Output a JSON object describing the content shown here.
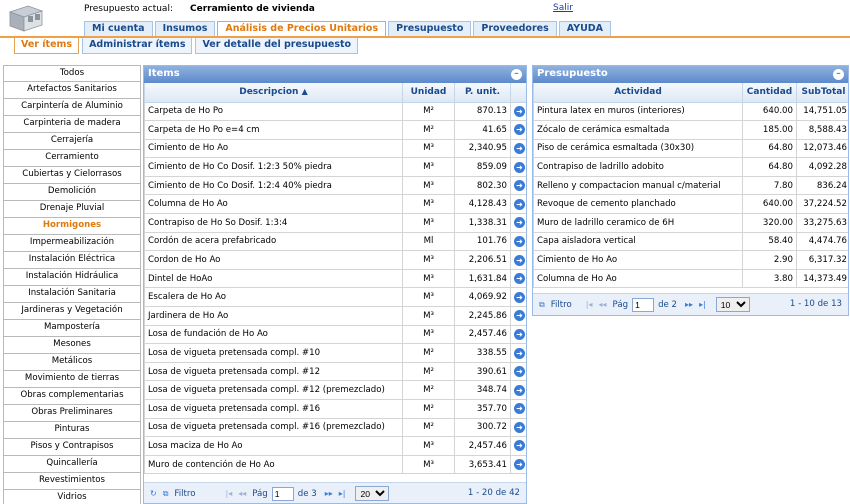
{
  "header": {
    "budget_label": "Presupuesto actual:",
    "budget_name": "Cerramiento de vivienda",
    "logout": "Salir"
  },
  "main_tabs": [
    "Mi cuenta",
    "Insumos",
    "Análisis de Precios Unitarios",
    "Presupuesto",
    "Proveedores",
    "AYUDA"
  ],
  "main_tab_active": 2,
  "sub_tabs": [
    "Ver ítems",
    "Administrar ítems",
    "Ver detalle del presupuesto"
  ],
  "sub_tab_active": 0,
  "categories": [
    "Todos",
    "Artefactos Sanitarios",
    "Carpintería de Aluminio",
    "Carpinteria de madera",
    "Cerrajería",
    "Cerramiento",
    "Cubiertas y Cielorrasos",
    "Demolición",
    "Drenaje Pluvial",
    "Hormigones",
    "Impermeabilización",
    "Instalación Eléctrica",
    "Instalación Hidráulica",
    "Instalación Sanitaria",
    "Jardineras y Vegetación",
    "Mampostería",
    "Mesones",
    "Metálicos",
    "Movimiento de tierras",
    "Obras complementarias",
    "Obras Preliminares",
    "Pinturas",
    "Pisos y Contrapisos",
    "Quincallería",
    "Revestimientos",
    "Vidrios"
  ],
  "category_active": 9,
  "items_panel": {
    "title": "Items",
    "columns": [
      "Descripcion",
      "Unidad",
      "P. unit."
    ],
    "rows": [
      [
        "Carpeta de Ho Po",
        "M²",
        "870.13"
      ],
      [
        "Carpeta de Ho Po e=4 cm",
        "M²",
        "41.65"
      ],
      [
        "Cimiento de Ho Ao",
        "M³",
        "2,340.95"
      ],
      [
        "Cimiento de Ho Co Dosif. 1:2:3 50% piedra",
        "M³",
        "859.09"
      ],
      [
        "Cimiento de Ho Co Dosif. 1:2:4 40% piedra",
        "M³",
        "802.30"
      ],
      [
        "Columna de Ho Ao",
        "M³",
        "4,128.43"
      ],
      [
        "Contrapiso de Ho So Dosif. 1:3:4",
        "M³",
        "1,338.31"
      ],
      [
        "Cordón de acera prefabricado",
        "Ml",
        "101.76"
      ],
      [
        "Cordon de Ho Ao",
        "M³",
        "2,206.51"
      ],
      [
        "Dintel de HoAo",
        "M³",
        "1,631.84"
      ],
      [
        "Escalera de Ho Ao",
        "M³",
        "4,069.92"
      ],
      [
        "Jardinera de Ho Ao",
        "M³",
        "2,245.86"
      ],
      [
        "Losa de fundación de Ho Ao",
        "M³",
        "2,457.46"
      ],
      [
        "Losa de vigueta pretensada compl. #10",
        "M²",
        "338.55"
      ],
      [
        "Losa de vigueta pretensada compl. #12",
        "M²",
        "390.61"
      ],
      [
        "Losa de vigueta pretensada compl. #12 (premezclado)",
        "M²",
        "348.74"
      ],
      [
        "Losa de vigueta pretensada compl. #16",
        "M²",
        "357.70"
      ],
      [
        "Losa de vigueta pretensada compl. #16 (premezclado)",
        "M²",
        "300.72"
      ],
      [
        "Losa maciza de Ho Ao",
        "M³",
        "2,457.46"
      ],
      [
        "Muro de contención de Ho Ao",
        "M³",
        "3,653.41"
      ]
    ],
    "pager": {
      "filter": "Filtro",
      "page_label": "Pág",
      "page": "1",
      "of": "de 3",
      "page_size": "20",
      "count": "1 - 20 de 42"
    }
  },
  "budget_panel": {
    "title": "Presupuesto",
    "columns": [
      "Actividad",
      "Cantidad",
      "SubTotal"
    ],
    "rows": [
      [
        "Pintura latex en muros (interiores)",
        "640.00",
        "14,751.05"
      ],
      [
        "Zócalo de cerámica esmaltada",
        "185.00",
        "8,588.43"
      ],
      [
        "Piso de cerámica esmaltada (30x30)",
        "64.80",
        "12,073.46"
      ],
      [
        "Contrapiso de ladrillo adobito",
        "64.80",
        "4,092.28"
      ],
      [
        "Relleno y compactacion manual c/material",
        "7.80",
        "836.24"
      ],
      [
        "Revoque de cemento planchado",
        "640.00",
        "37,224.52"
      ],
      [
        "Muro de ladrillo ceramico de 6H",
        "320.00",
        "33,275.63"
      ],
      [
        "Capa aisladora vertical",
        "58.40",
        "4,474.76"
      ],
      [
        "Cimiento de Ho Ao",
        "2.90",
        "6,317.32"
      ],
      [
        "Columna de Ho Ao",
        "3.80",
        "14,373.49"
      ]
    ],
    "pager": {
      "filter": "Filtro",
      "page_label": "Pág",
      "page": "1",
      "of": "de 2",
      "page_size": "10",
      "count": "1 - 10 de 13"
    }
  }
}
